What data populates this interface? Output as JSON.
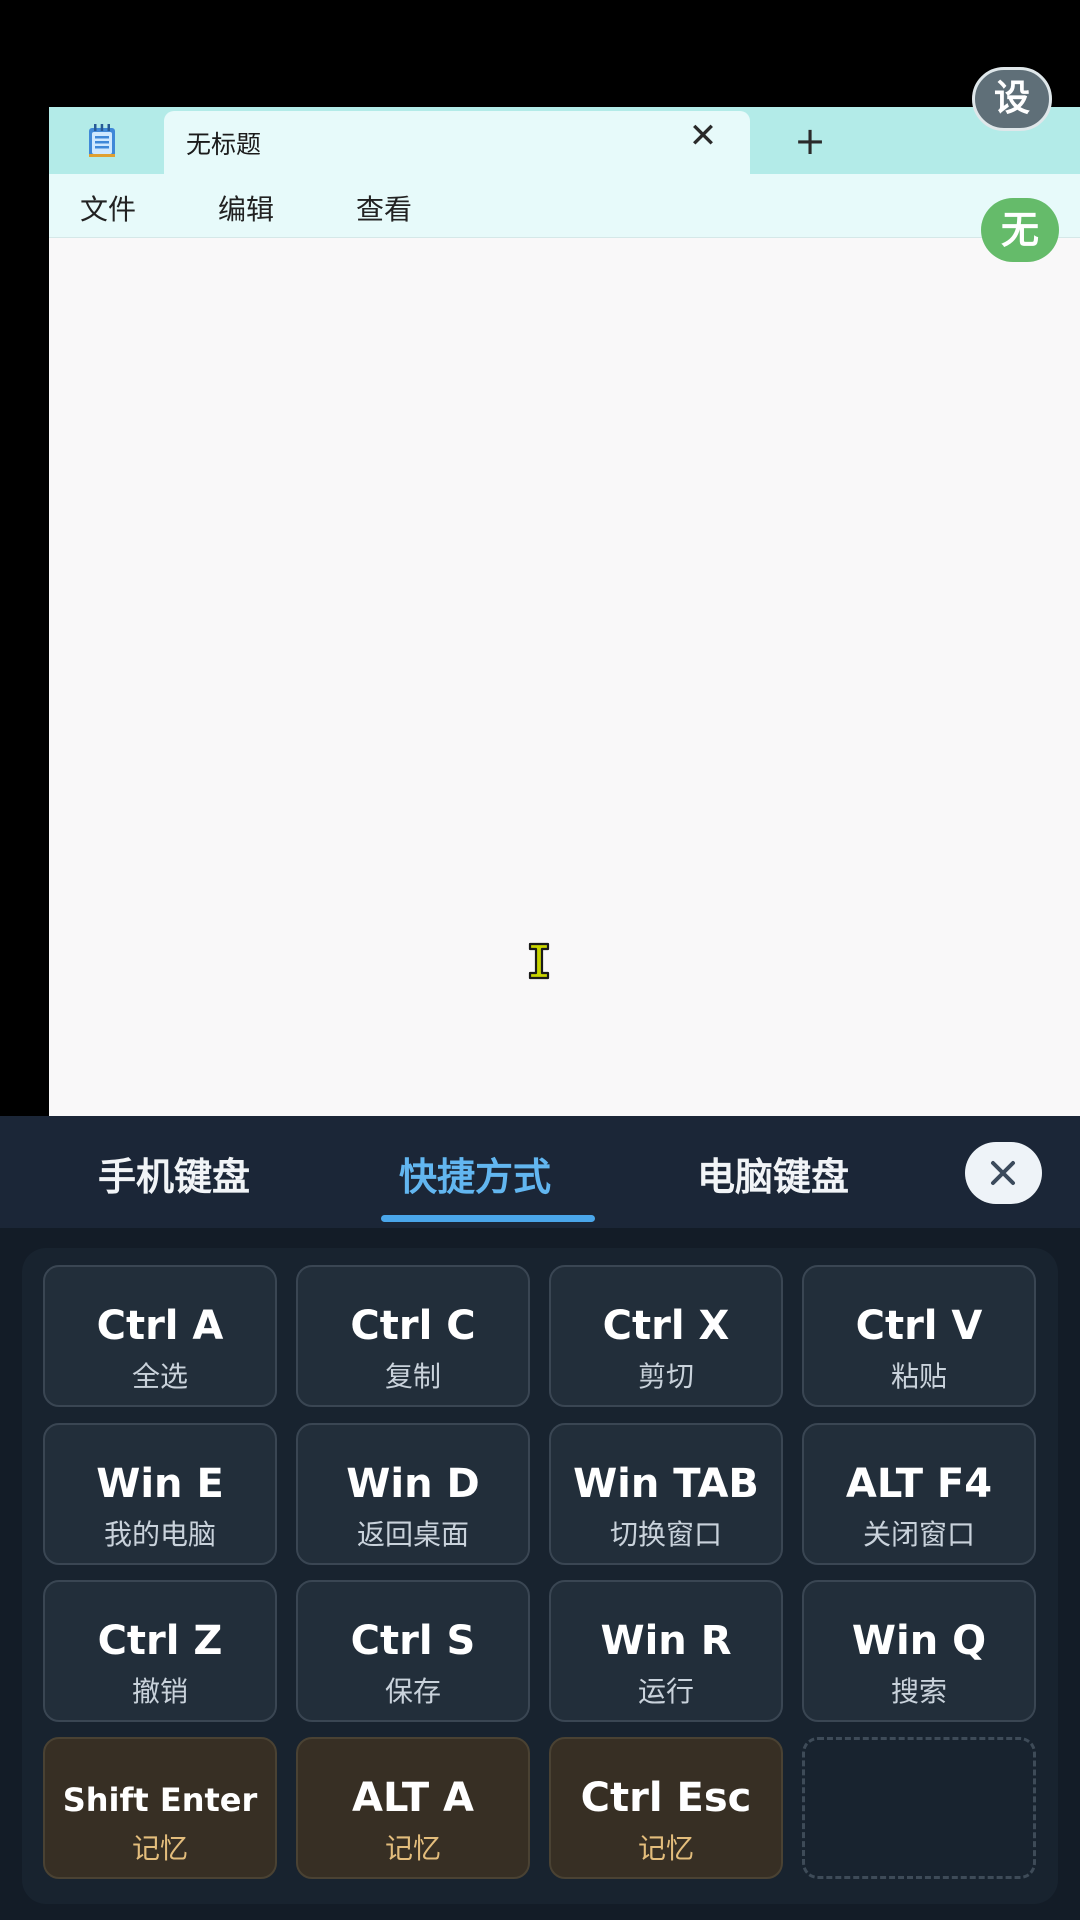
{
  "notepad": {
    "tab_title": "无标题",
    "tab_close_glyph": "✕",
    "new_tab_glyph": "+",
    "menu": [
      "文件",
      "编辑",
      "查看"
    ]
  },
  "floating": {
    "settings_label": "设",
    "input_mode_label": "无"
  },
  "keyboard_panel": {
    "tabs": [
      "手机键盘",
      "快捷方式",
      "电脑键盘"
    ],
    "active_tab": "快捷方式",
    "keys": [
      {
        "combo": "Ctrl A",
        "desc": "全选",
        "kind": "standard"
      },
      {
        "combo": "Ctrl C",
        "desc": "复制",
        "kind": "standard"
      },
      {
        "combo": "Ctrl X",
        "desc": "剪切",
        "kind": "standard"
      },
      {
        "combo": "Ctrl V",
        "desc": "粘贴",
        "kind": "standard"
      },
      {
        "combo": "Win E",
        "desc": "我的电脑",
        "kind": "standard"
      },
      {
        "combo": "Win D",
        "desc": "返回桌面",
        "kind": "standard"
      },
      {
        "combo": "Win TAB",
        "desc": "切换窗口",
        "kind": "standard"
      },
      {
        "combo": "ALT F4",
        "desc": "关闭窗口",
        "kind": "standard"
      },
      {
        "combo": "Ctrl Z",
        "desc": "撤销",
        "kind": "standard"
      },
      {
        "combo": "Ctrl S",
        "desc": "保存",
        "kind": "standard"
      },
      {
        "combo": "Win R",
        "desc": "运行",
        "kind": "standard"
      },
      {
        "combo": "Win Q",
        "desc": "搜索",
        "kind": "standard"
      },
      {
        "combo": "Shift Enter",
        "desc": "记忆",
        "kind": "memory"
      },
      {
        "combo": "ALT A",
        "desc": "记忆",
        "kind": "memory"
      },
      {
        "combo": "Ctrl Esc",
        "desc": "记忆",
        "kind": "memory"
      }
    ]
  },
  "colors": {
    "accent": "#62b6f0",
    "memory_text": "#e3bd7c",
    "settings_badge": "#5f6f78",
    "input_mode_badge": "#65bb6a"
  }
}
